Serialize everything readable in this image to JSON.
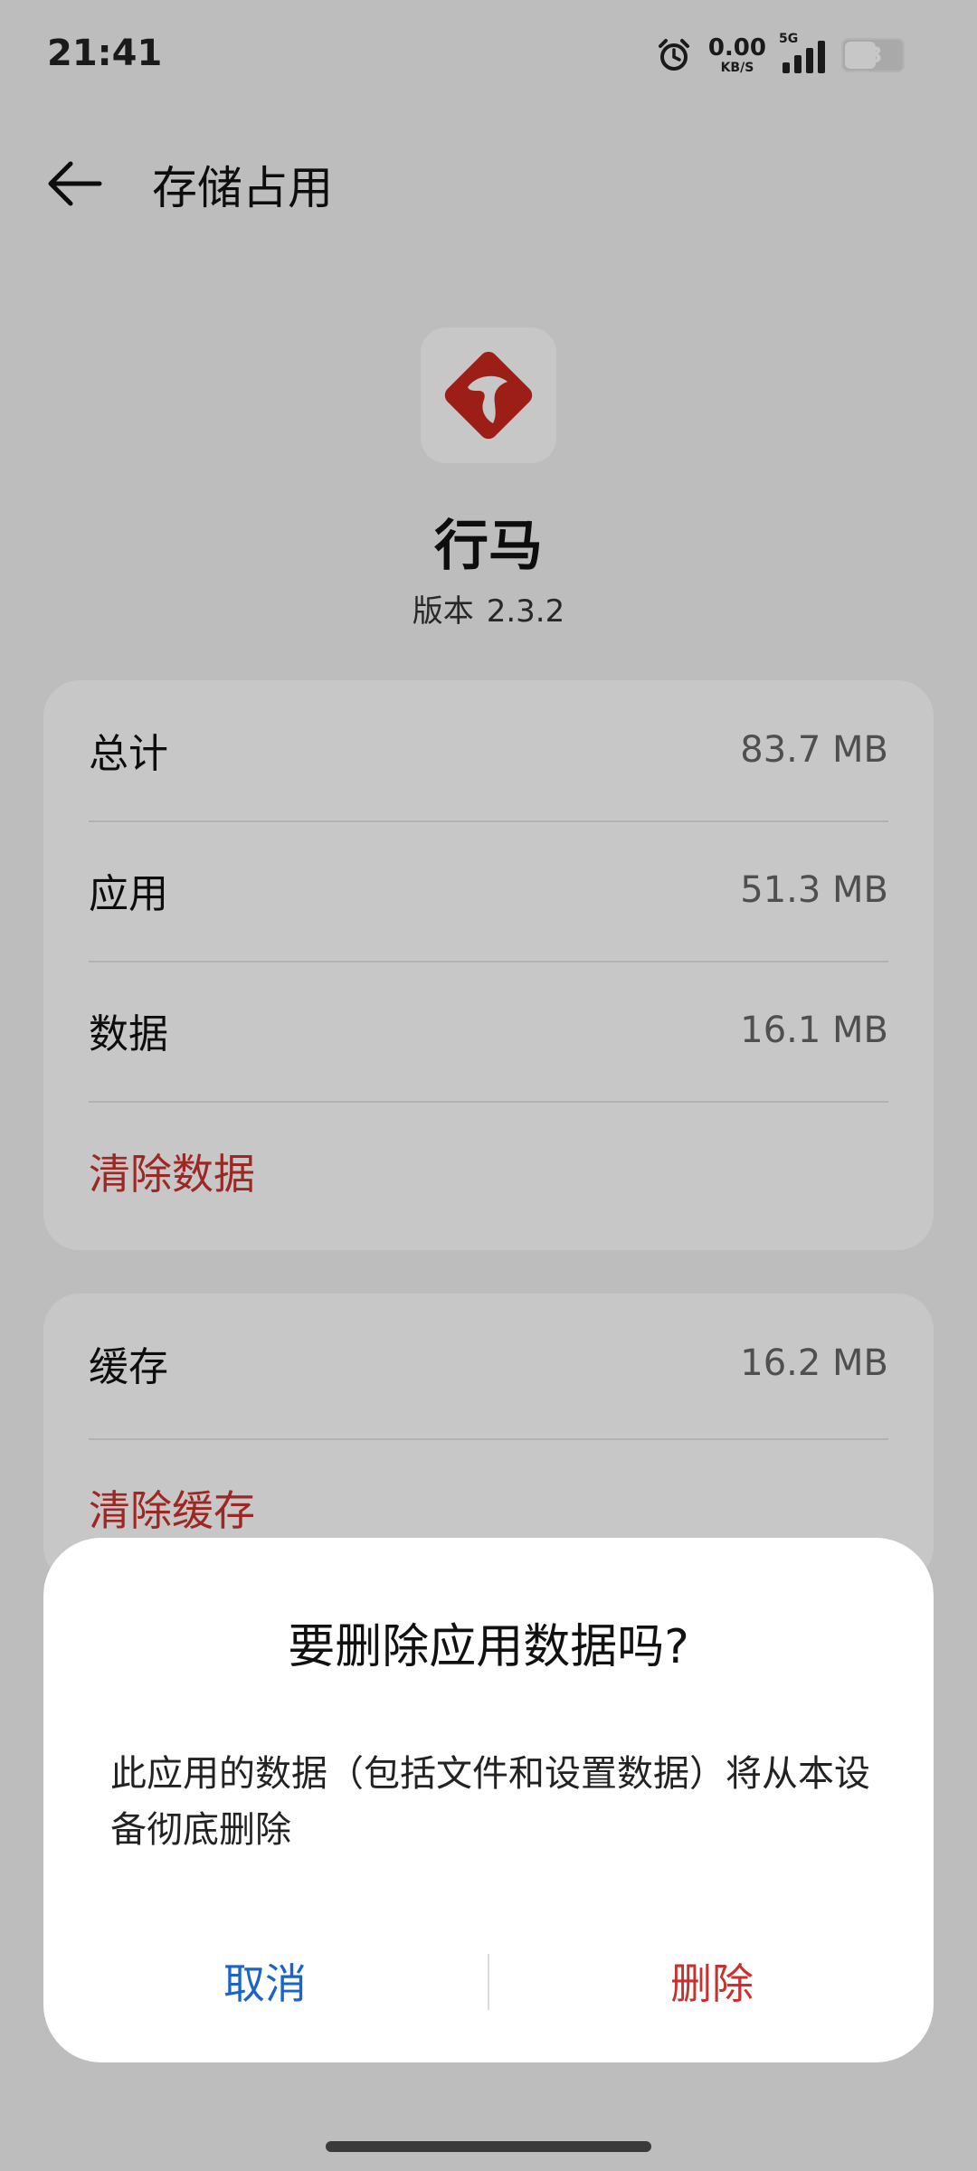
{
  "status_bar": {
    "time": "21:41",
    "net_speed": "0.00",
    "net_unit": "KB/S",
    "network": "5G",
    "battery": "53",
    "signal_bars": 4,
    "icons": [
      "alarm-icon",
      "signal-icon",
      "battery-icon"
    ]
  },
  "header": {
    "back_icon": "arrow-left-icon",
    "title": "存储占用"
  },
  "app": {
    "name": "行马",
    "version_label": "版本",
    "version": "2.3.2",
    "icon": "horse-app-icon",
    "icon_color": "#c8271d"
  },
  "storage": {
    "rows": [
      {
        "label": "总计",
        "value": "83.7 MB"
      },
      {
        "label": "应用",
        "value": "51.3 MB"
      },
      {
        "label": "数据",
        "value": "16.1 MB"
      }
    ],
    "clear_data_label": "清除数据"
  },
  "cache": {
    "label": "缓存",
    "value": "16.2 MB",
    "clear_cache_label": "清除缓存"
  },
  "dialog": {
    "title": "要删除应用数据吗?",
    "message": "此应用的数据（包括文件和设置数据）将从本设备彻底删除",
    "cancel_label": "取消",
    "delete_label": "删除"
  },
  "colors": {
    "accent_blue": "#1a63c9",
    "destructive_red": "#c8322e"
  }
}
